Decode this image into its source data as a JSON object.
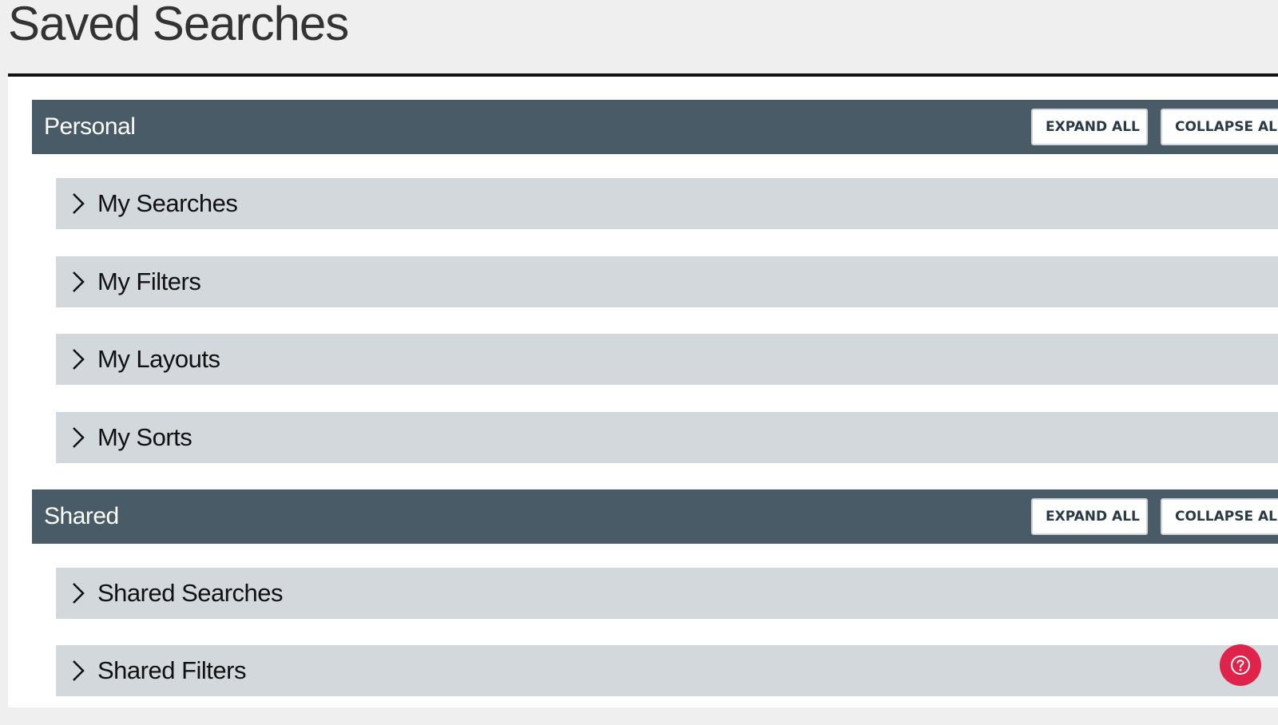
{
  "page": {
    "title": "Saved Searches"
  },
  "colors": {
    "header_bg": "#485b66",
    "item_bg": "#d3d8dd",
    "help_button": "#e0234a"
  },
  "sections": [
    {
      "title": "Personal",
      "expand_label": "EXPAND ALL",
      "collapse_label": "COLLAPSE ALL",
      "items": [
        {
          "label": "My Searches",
          "icon": "chevron-right-icon"
        },
        {
          "label": "My Filters",
          "icon": "chevron-right-icon"
        },
        {
          "label": "My Layouts",
          "icon": "chevron-right-icon"
        },
        {
          "label": "My Sorts",
          "icon": "chevron-right-icon"
        }
      ]
    },
    {
      "title": "Shared",
      "expand_label": "EXPAND ALL",
      "collapse_label": "COLLAPSE ALL",
      "items": [
        {
          "label": "Shared Searches",
          "icon": "chevron-right-icon"
        },
        {
          "label": "Shared Filters",
          "icon": "chevron-right-icon"
        }
      ]
    }
  ],
  "help": {
    "icon": "help-icon"
  }
}
